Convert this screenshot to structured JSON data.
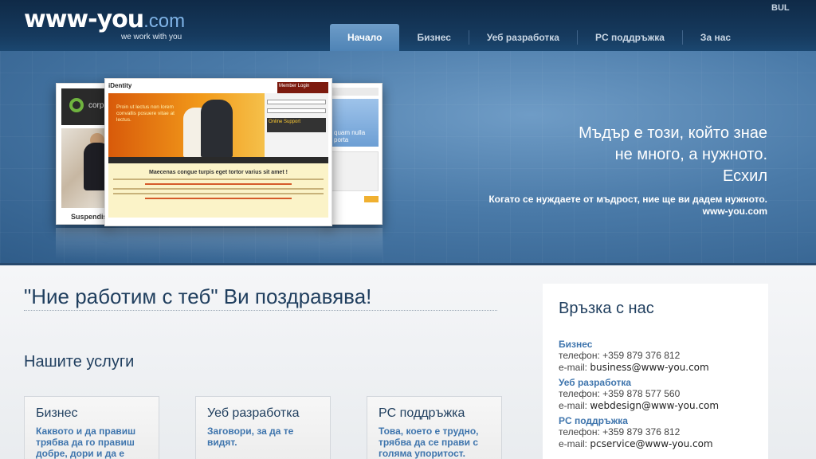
{
  "header": {
    "logo_main": "www-you",
    "logo_tld": ".com",
    "logo_tagline": "we work with you",
    "language": "BUL",
    "nav": [
      {
        "label": "Начало",
        "active": true
      },
      {
        "label": "Бизнес",
        "active": false
      },
      {
        "label": "Уеб разработка",
        "active": false
      },
      {
        "label": "PC поддръжка",
        "active": false
      },
      {
        "label": "За нас",
        "active": false
      }
    ]
  },
  "banner": {
    "quote_line1": "Мъдър е този, който знае",
    "quote_line2": "не много, а нужното.",
    "quote_author": "Есхил",
    "subtitle": "Когато се нуждаете от мъдрост, ние ще ви дадем нужното.",
    "subtitle_site": "www-you.com",
    "shots": {
      "left_word": "corpor",
      "left_sub": "Suspendisse",
      "right_text": "quam nulla porta",
      "main_logo": "iDentity",
      "main_member": "Member Login",
      "main_hero_text": "Proin ut lectus non lorem convallis posuere vitae at lectus.",
      "main_support": "Online Support",
      "main_heading": "Maecenas congue turpis eget tortor varius sit amet !"
    }
  },
  "main": {
    "welcome": "\"Ние работим с теб\" Ви поздравява!",
    "services_title": "Нашите услуги",
    "services": [
      {
        "title": "Бизнес",
        "text": "Каквото и да правиш трябва да го правиш добре, дори и да е"
      },
      {
        "title": "Уеб разработка",
        "text": "Заговори, за да те видят."
      },
      {
        "title": "PC поддръжка",
        "text": "Това, което е трудно, трябва да се прави с голяма упоритост."
      }
    ]
  },
  "contact": {
    "title": "Връзка с нас",
    "entries": [
      {
        "name": "Бизнес",
        "phone": "телефон: +359 879 376 812",
        "email_label": "e-mail:",
        "email": "business@www-you.com"
      },
      {
        "name": "Уеб разработка",
        "phone": "телефон: +359 878 577 560",
        "email_label": "e-mail:",
        "email": "webdesign@www-you.com"
      },
      {
        "name": "PC поддръжка",
        "phone": "телефон: +359 879 376 812",
        "email_label": "e-mail:",
        "email": "pcservice@www-you.com"
      }
    ]
  }
}
